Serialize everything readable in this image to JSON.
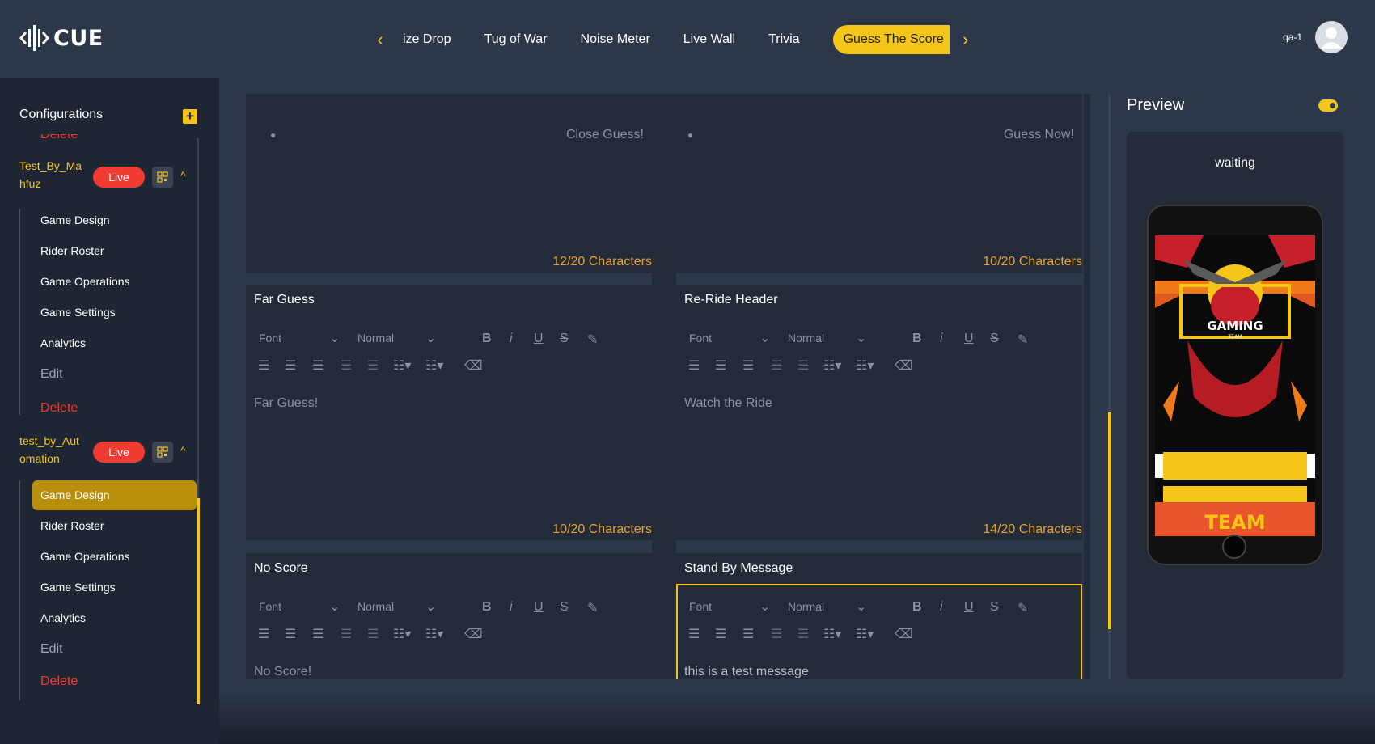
{
  "app": {
    "logo_text": "CUE"
  },
  "nav": {
    "tabs": [
      "ize Drop",
      "Tug of War",
      "Noise Meter",
      "Live Wall",
      "Trivia"
    ],
    "active_tab": "Guess The Score"
  },
  "user": {
    "name": "qa-1"
  },
  "sidebar": {
    "title": "Configurations",
    "cut_item": "Delete",
    "configs": [
      {
        "name": "Test_By_Ma hfuz",
        "badge": "Live",
        "items": [
          "Game Design",
          "Rider Roster",
          "Game Operations",
          "Game Settings",
          "Analytics"
        ],
        "edit": "Edit",
        "delete": "Delete"
      },
      {
        "name": "test_by_Aut omation",
        "badge": "Live",
        "items": [
          "Game Design",
          "Rider Roster",
          "Game Operations",
          "Game Settings",
          "Analytics"
        ],
        "edit": "Edit",
        "delete": "Delete"
      }
    ]
  },
  "toolbar": {
    "font_label": "Font",
    "size_label": "Normal"
  },
  "editors": {
    "top_left": {
      "text": "Close Guess!",
      "chars": "12/20 Characters"
    },
    "top_right": {
      "text": "Guess Now!",
      "chars": "10/20 Characters"
    },
    "far_guess": {
      "title": "Far Guess",
      "text": "Far Guess!",
      "chars": "10/20 Characters"
    },
    "reride": {
      "title": "Re-Ride Header",
      "text": "Watch the Ride",
      "chars": "14/20 Characters"
    },
    "no_score": {
      "title": "No Score",
      "text": "No Score!"
    },
    "standby": {
      "title": "Stand By Message",
      "text": "this is a test message"
    }
  },
  "preview": {
    "title": "Preview",
    "status": "waiting",
    "phone_text": {
      "emblem": "GAMING",
      "emblem_sub": "TEAM",
      "banner": "TEAM"
    }
  },
  "colors": {
    "accent": "#f5c518",
    "live": "#ef3b32",
    "char_count": "#e8a12c"
  }
}
